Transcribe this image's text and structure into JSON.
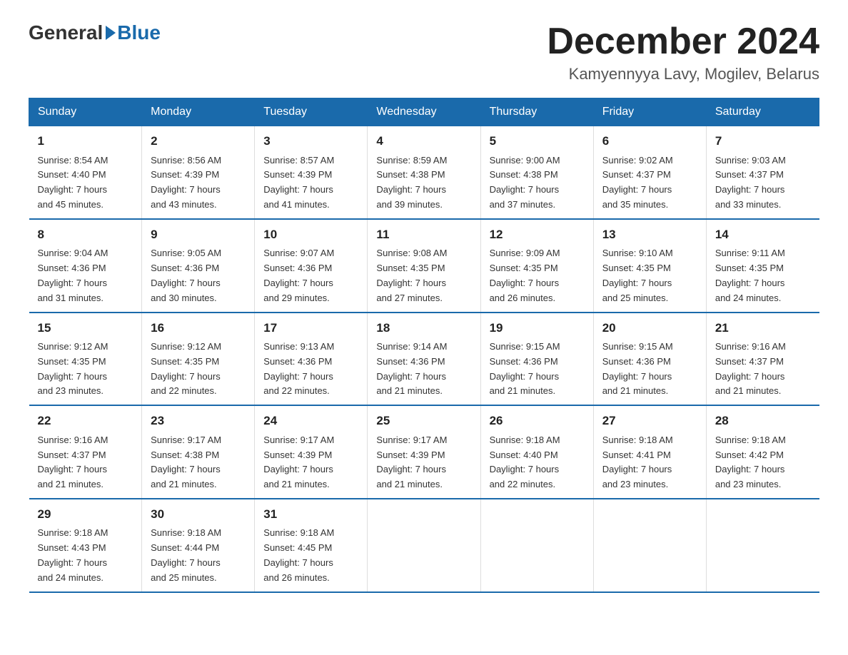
{
  "logo": {
    "general": "General",
    "blue": "Blue",
    "subtitle": ""
  },
  "title": "December 2024",
  "location": "Kamyennyya Lavy, Mogilev, Belarus",
  "weekdays": [
    "Sunday",
    "Monday",
    "Tuesday",
    "Wednesday",
    "Thursday",
    "Friday",
    "Saturday"
  ],
  "weeks": [
    [
      {
        "day": "1",
        "sunrise": "8:54 AM",
        "sunset": "4:40 PM",
        "daylight": "7 hours and 45 minutes."
      },
      {
        "day": "2",
        "sunrise": "8:56 AM",
        "sunset": "4:39 PM",
        "daylight": "7 hours and 43 minutes."
      },
      {
        "day": "3",
        "sunrise": "8:57 AM",
        "sunset": "4:39 PM",
        "daylight": "7 hours and 41 minutes."
      },
      {
        "day": "4",
        "sunrise": "8:59 AM",
        "sunset": "4:38 PM",
        "daylight": "7 hours and 39 minutes."
      },
      {
        "day": "5",
        "sunrise": "9:00 AM",
        "sunset": "4:38 PM",
        "daylight": "7 hours and 37 minutes."
      },
      {
        "day": "6",
        "sunrise": "9:02 AM",
        "sunset": "4:37 PM",
        "daylight": "7 hours and 35 minutes."
      },
      {
        "day": "7",
        "sunrise": "9:03 AM",
        "sunset": "4:37 PM",
        "daylight": "7 hours and 33 minutes."
      }
    ],
    [
      {
        "day": "8",
        "sunrise": "9:04 AM",
        "sunset": "4:36 PM",
        "daylight": "7 hours and 31 minutes."
      },
      {
        "day": "9",
        "sunrise": "9:05 AM",
        "sunset": "4:36 PM",
        "daylight": "7 hours and 30 minutes."
      },
      {
        "day": "10",
        "sunrise": "9:07 AM",
        "sunset": "4:36 PM",
        "daylight": "7 hours and 29 minutes."
      },
      {
        "day": "11",
        "sunrise": "9:08 AM",
        "sunset": "4:35 PM",
        "daylight": "7 hours and 27 minutes."
      },
      {
        "day": "12",
        "sunrise": "9:09 AM",
        "sunset": "4:35 PM",
        "daylight": "7 hours and 26 minutes."
      },
      {
        "day": "13",
        "sunrise": "9:10 AM",
        "sunset": "4:35 PM",
        "daylight": "7 hours and 25 minutes."
      },
      {
        "day": "14",
        "sunrise": "9:11 AM",
        "sunset": "4:35 PM",
        "daylight": "7 hours and 24 minutes."
      }
    ],
    [
      {
        "day": "15",
        "sunrise": "9:12 AM",
        "sunset": "4:35 PM",
        "daylight": "7 hours and 23 minutes."
      },
      {
        "day": "16",
        "sunrise": "9:12 AM",
        "sunset": "4:35 PM",
        "daylight": "7 hours and 22 minutes."
      },
      {
        "day": "17",
        "sunrise": "9:13 AM",
        "sunset": "4:36 PM",
        "daylight": "7 hours and 22 minutes."
      },
      {
        "day": "18",
        "sunrise": "9:14 AM",
        "sunset": "4:36 PM",
        "daylight": "7 hours and 21 minutes."
      },
      {
        "day": "19",
        "sunrise": "9:15 AM",
        "sunset": "4:36 PM",
        "daylight": "7 hours and 21 minutes."
      },
      {
        "day": "20",
        "sunrise": "9:15 AM",
        "sunset": "4:36 PM",
        "daylight": "7 hours and 21 minutes."
      },
      {
        "day": "21",
        "sunrise": "9:16 AM",
        "sunset": "4:37 PM",
        "daylight": "7 hours and 21 minutes."
      }
    ],
    [
      {
        "day": "22",
        "sunrise": "9:16 AM",
        "sunset": "4:37 PM",
        "daylight": "7 hours and 21 minutes."
      },
      {
        "day": "23",
        "sunrise": "9:17 AM",
        "sunset": "4:38 PM",
        "daylight": "7 hours and 21 minutes."
      },
      {
        "day": "24",
        "sunrise": "9:17 AM",
        "sunset": "4:39 PM",
        "daylight": "7 hours and 21 minutes."
      },
      {
        "day": "25",
        "sunrise": "9:17 AM",
        "sunset": "4:39 PM",
        "daylight": "7 hours and 21 minutes."
      },
      {
        "day": "26",
        "sunrise": "9:18 AM",
        "sunset": "4:40 PM",
        "daylight": "7 hours and 22 minutes."
      },
      {
        "day": "27",
        "sunrise": "9:18 AM",
        "sunset": "4:41 PM",
        "daylight": "7 hours and 23 minutes."
      },
      {
        "day": "28",
        "sunrise": "9:18 AM",
        "sunset": "4:42 PM",
        "daylight": "7 hours and 23 minutes."
      }
    ],
    [
      {
        "day": "29",
        "sunrise": "9:18 AM",
        "sunset": "4:43 PM",
        "daylight": "7 hours and 24 minutes."
      },
      {
        "day": "30",
        "sunrise": "9:18 AM",
        "sunset": "4:44 PM",
        "daylight": "7 hours and 25 minutes."
      },
      {
        "day": "31",
        "sunrise": "9:18 AM",
        "sunset": "4:45 PM",
        "daylight": "7 hours and 26 minutes."
      },
      null,
      null,
      null,
      null
    ]
  ],
  "labels": {
    "sunrise": "Sunrise:",
    "sunset": "Sunset:",
    "daylight": "Daylight:"
  }
}
